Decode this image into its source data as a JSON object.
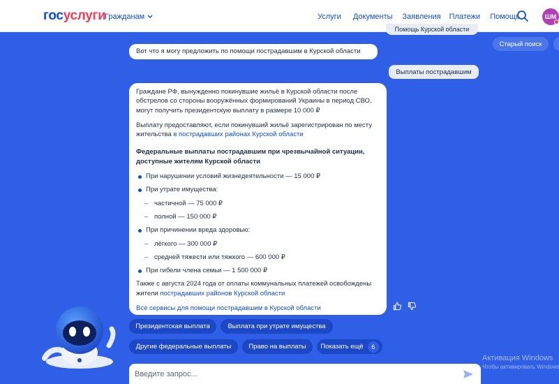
{
  "header": {
    "logo_part1": "гос",
    "logo_part2": "услуги",
    "citizens_label": "Гражданам",
    "nav": [
      "Услуги",
      "Документы",
      "Заявления",
      "Платежи",
      "Помощь"
    ],
    "avatar_initials": "ШМ"
  },
  "chat": {
    "partial_message": "Помощь Курской области",
    "old_search_label": "Старый поиск",
    "intro_message": "Вот что я могу предложить по помощи пострадавшим в Курской области",
    "user_message": "Выплаты пострадавшим",
    "answer": {
      "para1": "Граждане РФ, вынужденно покинувшие жильё в Курской области после обстрелов со стороны вооружённых формирований Украины в период СВО, могут получить президентскую выплату в размере 10 000 ₽",
      "para2_text": "Выплату предоставляют, если покинувший жильё зарегистрирован по месту жительства ",
      "para2_link": "в пострадавших районах Курской области",
      "heading": "Федеральные выплаты пострадавшим при чрезвычайной ситуации, доступные жителям Курской области",
      "items": [
        "При нарушении условий жизнедеятельности — 15 000 ₽",
        "При утрате имущества:",
        "частичной — 75 000 ₽",
        "полной — 150 000 ₽",
        "При причинении вреда здоровью:",
        "лёгкого — 300 000 ₽",
        "средней тяжести или тяжкого — 600 000 ₽",
        "При гибели члена семьи — 1 500 000 ₽"
      ],
      "para3_text": "Также с августа 2024 года от оплаты коммунальных платежей освобождены жители ",
      "para3_link": "пострадавших районов Курской области",
      "footer_link": "Все сервисы для помощи пострадавшим в Курской области"
    }
  },
  "quick_replies": {
    "r1": "Президентская выплата",
    "r2": "Выплата при утрате имущества",
    "r3": "Другие федеральные выплаты",
    "r4": "Право на выплаты",
    "r5": "Показать ещё",
    "r5_count": "6"
  },
  "input": {
    "placeholder": "Введите запрос..."
  },
  "watermark": {
    "line1": "Активация Windows",
    "line2": "Чтобы активировать Windows"
  },
  "colors": {
    "background": "#2f5fe6",
    "accent": "#0d4cd3",
    "logo_red": "#ee3f58",
    "chip": "#1c47c7",
    "avatar": "#b23fb7"
  },
  "icons": [
    "chevron-down-icon",
    "search-icon",
    "thumbs-up-icon",
    "thumbs-down-icon",
    "send-icon",
    "robot-mascot"
  ]
}
